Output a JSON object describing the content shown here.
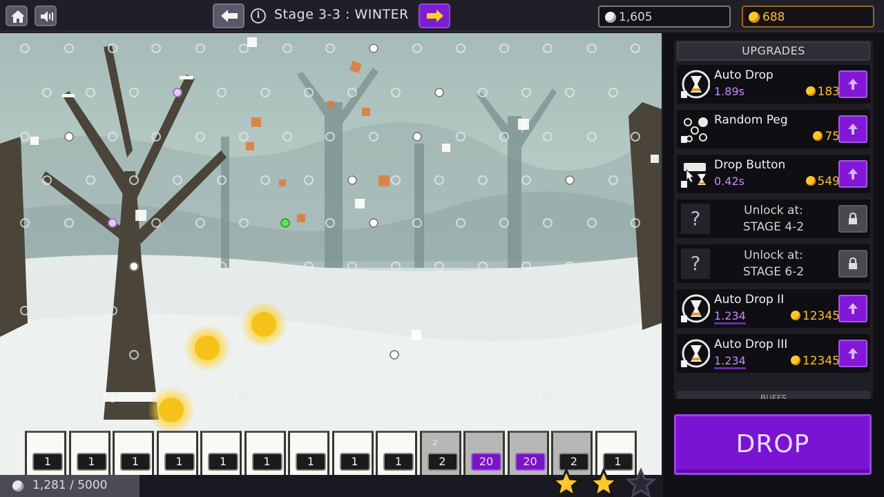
{
  "topbar": {
    "stage_title": "Stage 3-3 : WINTER",
    "info_glyph": "i",
    "silver": "1,605",
    "gold": "688",
    "icons": [
      "home-icon",
      "sound-icon",
      "arrow-left-icon",
      "info-icon",
      "arrow-right-icon",
      "silver-ball-icon",
      "gold-coin-icon"
    ]
  },
  "colors": {
    "accent_purple": "#7b13d3",
    "gold": "#ffbf2d",
    "silver": "#d8d8d8",
    "panel_dark": "#111014"
  },
  "sidebar": {
    "header": "UPGRADES",
    "upgrades": [
      {
        "name": "Auto Drop",
        "sub": "1.89s",
        "cost": "183",
        "icon": "hourglass-icon",
        "underline": false
      },
      {
        "name": "Random Peg",
        "sub": "",
        "cost": "75",
        "icon": "random-peg-icon",
        "underline": false
      },
      {
        "name": "Drop Button",
        "sub": "0.42s",
        "cost": "549",
        "icon": "drop-button-icon",
        "underline": false
      }
    ],
    "locked": [
      {
        "line1": "Unlock at:",
        "line2": "STAGE 4-2",
        "glyph": "?"
      },
      {
        "line1": "Unlock at:",
        "line2": "STAGE 6-2",
        "glyph": "?"
      }
    ],
    "upgrades2": [
      {
        "name": "Auto Drop II",
        "sub": "1.234",
        "cost": "12345",
        "icon": "hourglass-icon",
        "underline": true
      },
      {
        "name": "Auto Drop III",
        "sub": "1.234",
        "cost": "12345",
        "icon": "hourglass-icon",
        "underline": true
      }
    ],
    "next_section_peek": "BUFFS",
    "drop_label": "DROP"
  },
  "bins": [
    {
      "value": "1",
      "style": "normal"
    },
    {
      "value": "1",
      "style": "normal"
    },
    {
      "value": "1",
      "style": "normal"
    },
    {
      "value": "1",
      "style": "normal"
    },
    {
      "value": "1",
      "style": "normal"
    },
    {
      "value": "1",
      "style": "normal"
    },
    {
      "value": "1",
      "style": "normal"
    },
    {
      "value": "1",
      "style": "normal"
    },
    {
      "value": "1",
      "style": "normal"
    },
    {
      "value": "2",
      "style": "normal",
      "mini": "2"
    },
    {
      "value": "20",
      "style": "purple"
    },
    {
      "value": "20",
      "style": "purple"
    },
    {
      "value": "2",
      "style": "normal"
    },
    {
      "value": "1",
      "style": "normal"
    }
  ],
  "progress": {
    "current": 1281,
    "goal": 5000,
    "text": "1,281 / 5000"
  },
  "stars": {
    "earned": 2,
    "total": 3
  }
}
